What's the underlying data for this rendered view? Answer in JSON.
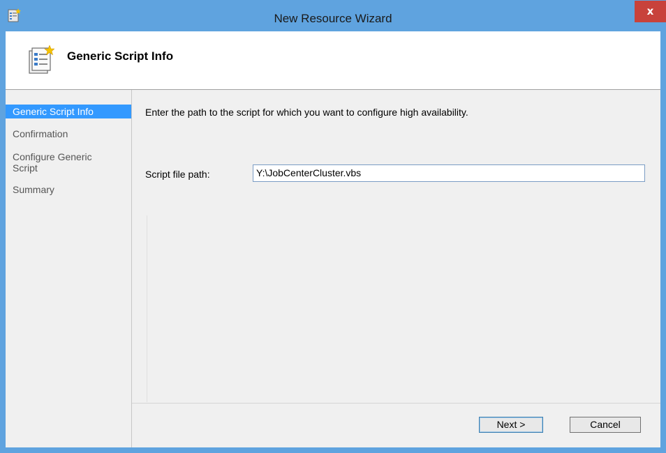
{
  "window": {
    "title": "New Resource Wizard",
    "close_label": "x"
  },
  "header": {
    "title": "Generic Script Info",
    "icon": "wizard-checklist-icon"
  },
  "nav": {
    "items": [
      {
        "label": "Generic Script Info",
        "active": true
      },
      {
        "label": "Confirmation",
        "active": false
      },
      {
        "label": "Configure Generic Script",
        "active": false
      },
      {
        "label": "Summary",
        "active": false
      }
    ]
  },
  "main": {
    "instruction": "Enter the path to the script for which you want to configure high availability.",
    "path_label": "Script file path:",
    "path_value": "Y:\\JobCenterCluster.vbs"
  },
  "buttons": {
    "next": "Next >",
    "cancel": "Cancel"
  },
  "colors": {
    "window_border": "#5fa3df",
    "close_button": "#c8423b",
    "selection": "#3399ff"
  }
}
